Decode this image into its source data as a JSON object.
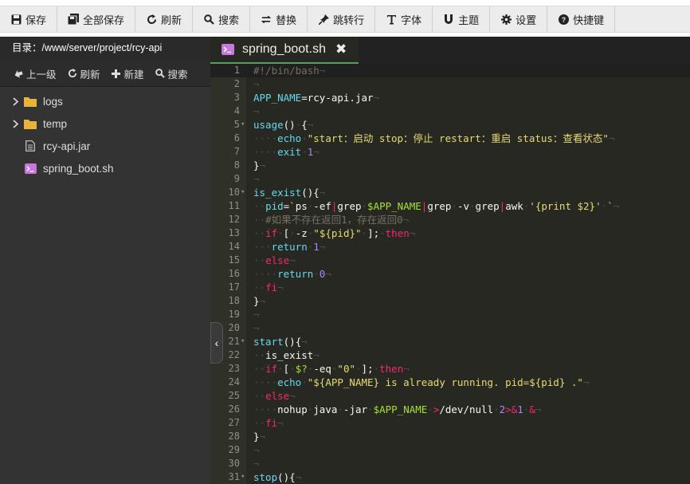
{
  "toolbar": {
    "items": [
      {
        "label": "保存",
        "icon": "save-icon"
      },
      {
        "label": "全部保存",
        "icon": "save-all-icon"
      },
      {
        "label": "刷新",
        "icon": "refresh-icon"
      },
      {
        "label": "搜索",
        "icon": "search-icon"
      },
      {
        "label": "替换",
        "icon": "replace-icon"
      },
      {
        "label": "跳转行",
        "icon": "pin-icon"
      },
      {
        "label": "字体",
        "icon": "font-icon"
      },
      {
        "label": "主题",
        "icon": "theme-icon"
      },
      {
        "label": "设置",
        "icon": "gear-icon"
      },
      {
        "label": "快捷键",
        "icon": "help-icon"
      }
    ]
  },
  "sidebar": {
    "directory_label": "目录：/www/server/project/rcy-api",
    "tools": [
      {
        "label": "上一级",
        "icon": "up-level-icon"
      },
      {
        "label": "刷新",
        "icon": "refresh-icon"
      },
      {
        "label": "新建",
        "icon": "plus-icon"
      },
      {
        "label": "搜索",
        "icon": "search-icon"
      }
    ],
    "files": [
      {
        "name": "logs",
        "type": "folder"
      },
      {
        "name": "temp",
        "type": "folder"
      },
      {
        "name": "rcy-api.jar",
        "type": "file"
      },
      {
        "name": "spring_boot.sh",
        "type": "script"
      }
    ]
  },
  "editor": {
    "tab_name": "spring_boot.sh",
    "close_symbol": "✖",
    "collapse_symbol": "‹",
    "lines": [
      "#!/bin/bash",
      "",
      "APP_NAME=rcy-api.jar",
      "",
      "usage() {",
      "    echo \"start：启动 stop：停止 restart：重启 status：查看状态\"",
      "    exit 1",
      "}",
      "",
      "is_exist(){",
      "  pid=`ps -ef|grep $APP_NAME|grep -v grep|awk '{print $2}' `",
      "  #如果不存在返回1，存在返回0",
      "  if [ -z \"${pid}\" ]; then",
      "   return 1",
      "  else",
      "    return 0",
      "  fi",
      "}",
      "",
      "",
      "start(){",
      "  is_exist",
      "  if [ $? -eq \"0\" ]; then",
      "    echo \"${APP_NAME} is already running. pid=${pid} .\"",
      "  else",
      "    nohup java -jar $APP_NAME >/dev/null 2>&1 &",
      "  fi",
      "}",
      "",
      "",
      "stop(){"
    ]
  }
}
